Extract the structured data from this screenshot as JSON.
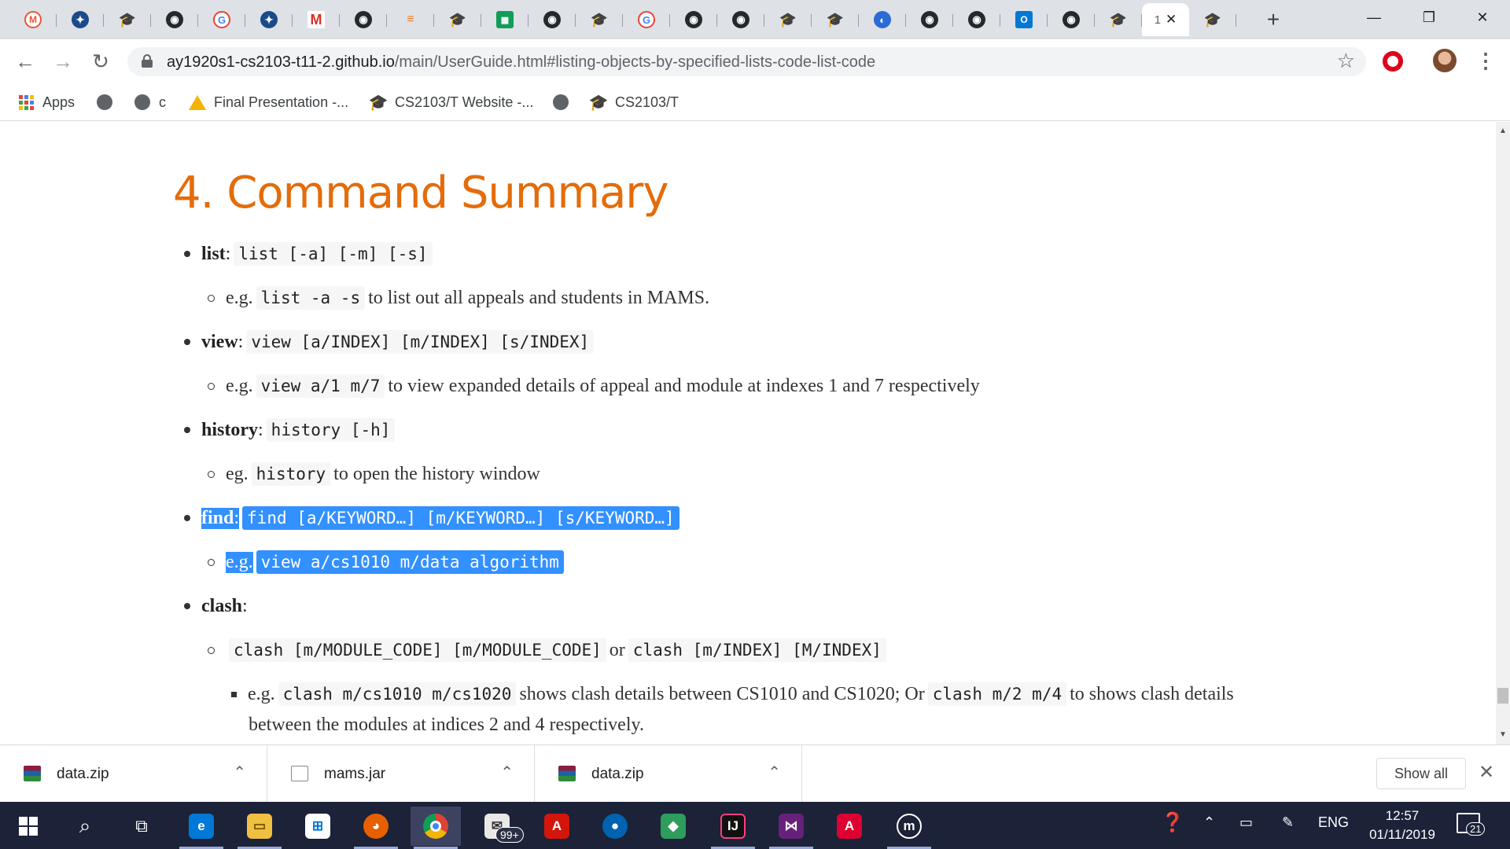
{
  "browser": {
    "tabs": [
      {
        "icon": "M",
        "icon_name": "memrise-icon",
        "cls": "fav-mem"
      },
      {
        "icon": "✦",
        "icon_name": "brand-icon",
        "cls": "fav-brand"
      },
      {
        "icon": "🎓",
        "icon_name": "graduation-cap-icon",
        "cls": "fav-cap"
      },
      {
        "icon": "◉",
        "icon_name": "github-icon",
        "cls": "fav-github"
      },
      {
        "icon": "G",
        "icon_name": "google-icon",
        "cls": "fav-google"
      },
      {
        "icon": "✦",
        "icon_name": "brand-icon",
        "cls": "fav-brand"
      },
      {
        "icon": "M",
        "icon_name": "gmail-icon",
        "cls": "fav-gmail"
      },
      {
        "icon": "◉",
        "icon_name": "github-icon",
        "cls": "fav-github"
      },
      {
        "icon": "≡",
        "icon_name": "stackoverflow-icon",
        "cls": "fav-so"
      },
      {
        "icon": "🎓",
        "icon_name": "graduation-cap-icon",
        "cls": "fav-cap"
      },
      {
        "icon": "▦",
        "icon_name": "sheets-icon",
        "cls": "fav-sheets"
      },
      {
        "icon": "◉",
        "icon_name": "github-icon",
        "cls": "fav-github"
      },
      {
        "icon": "🎓",
        "icon_name": "graduation-cap-icon",
        "cls": "fav-cap"
      },
      {
        "icon": "G",
        "icon_name": "google-icon",
        "cls": "fav-google"
      },
      {
        "icon": "◉",
        "icon_name": "github-icon",
        "cls": "fav-github"
      },
      {
        "icon": "◉",
        "icon_name": "github-icon",
        "cls": "fav-github"
      },
      {
        "icon": "🎓",
        "icon_name": "graduation-cap-icon",
        "cls": "fav-cap"
      },
      {
        "icon": "🎓",
        "icon_name": "graduation-cap-icon",
        "cls": "fav-cap"
      },
      {
        "icon": "◐",
        "icon_name": "loading-icon",
        "cls": "fav-blue"
      },
      {
        "icon": "◉",
        "icon_name": "github-icon",
        "cls": "fav-github"
      },
      {
        "icon": "◉",
        "icon_name": "github-icon",
        "cls": "fav-github"
      },
      {
        "icon": "O",
        "icon_name": "outlook-icon",
        "cls": "fav-outlook"
      },
      {
        "icon": "◉",
        "icon_name": "github-icon",
        "cls": "fav-github"
      },
      {
        "icon": "🎓",
        "icon_name": "graduation-cap-icon",
        "cls": "fav-cap"
      }
    ],
    "active_tab": {
      "title": "1",
      "close": "✕"
    },
    "after_active_tab": {
      "icon": "🎓",
      "icon_name": "graduation-cap-icon",
      "cls": "fav-cap"
    },
    "new_tab": "+",
    "window": {
      "minimize": "—",
      "restore": "❐",
      "close": "✕"
    },
    "nav": {
      "back": "←",
      "forward": "→",
      "reload": "↻"
    },
    "url": {
      "host": "ay1920s1-cs2103-t11-2.github.io",
      "path": "/main/UserGuide.html#listing-objects-by-specified-lists-code-list-code"
    },
    "star": "☆",
    "menu": "⋮",
    "bookmarks": [
      {
        "label": "Apps",
        "icon": "apps-grid-icon"
      },
      {
        "label": "",
        "icon": "globe-icon"
      },
      {
        "label": "c",
        "icon": "globe-icon"
      },
      {
        "label": "Final Presentation -...",
        "icon": "drive-icon"
      },
      {
        "label": "CS2103/T Website -...",
        "icon": "graduation-cap-icon"
      },
      {
        "label": "",
        "icon": "globe-icon"
      },
      {
        "label": "CS2103/T",
        "icon": "graduation-cap-icon"
      }
    ]
  },
  "doc": {
    "heading": "4. Command Summary",
    "items": {
      "list": {
        "name": "list",
        "colon": ":",
        "syntax": "list [-a] [-m] [-s]",
        "eg": "e.g.",
        "example_code": "list -a -s",
        "example_text": "to list out all appeals and students in MAMS."
      },
      "view": {
        "name": "view",
        "colon": ":",
        "syntax": "view [a/INDEX] [m/INDEX] [s/INDEX]",
        "eg": "e.g.",
        "example_code": "view a/1 m/7",
        "example_text": "to view expanded details of appeal and module at indexes 1 and 7 respectively"
      },
      "history": {
        "name": "history",
        "colon": ":",
        "syntax": "history [-h]",
        "eg": "eg.",
        "example_code": "history",
        "example_text": "to open the history window"
      },
      "find": {
        "name": "find",
        "colon": ":",
        "syntax": "find [a/KEYWORD…] [m/KEYWORD…] [s/KEYWORD…]",
        "eg": "e.g.",
        "example_code": "view a/cs1010 m/data algorithm"
      },
      "clash": {
        "name": "clash",
        "colon": ":",
        "syntax1": "clash [m/MODULE_CODE] [m/MODULE_CODE]",
        "or": "or",
        "syntax2": "clash [m/INDEX] [M/INDEX]",
        "eg": "e.g.",
        "example_code1": "clash m/cs1010 m/cs1020",
        "example_text1": "shows clash details between CS1010 and CS1020; Or",
        "example_code2": "clash m/2 m/4",
        "example_text2": "to shows clash details",
        "example_text3": "between the modules at indices 2 and 4 respectively."
      }
    }
  },
  "downloads": {
    "files": [
      {
        "name": "data.zip",
        "icon": "winrar-icon"
      },
      {
        "name": "mams.jar",
        "icon": "java-file-icon"
      },
      {
        "name": "data.zip",
        "icon": "winrar-icon"
      }
    ],
    "chevron": "⌃",
    "show_all": "Show all",
    "close": "✕"
  },
  "taskbar": {
    "mail_badge": "99+",
    "language": "ENG",
    "time": "12:57",
    "date": "01/11/2019",
    "notifications": "21"
  },
  "colors": {
    "heading": "#e46c0a",
    "selection": "#3390ff",
    "taskbar": "#1c2238",
    "tabstrip": "#dee1e6"
  }
}
